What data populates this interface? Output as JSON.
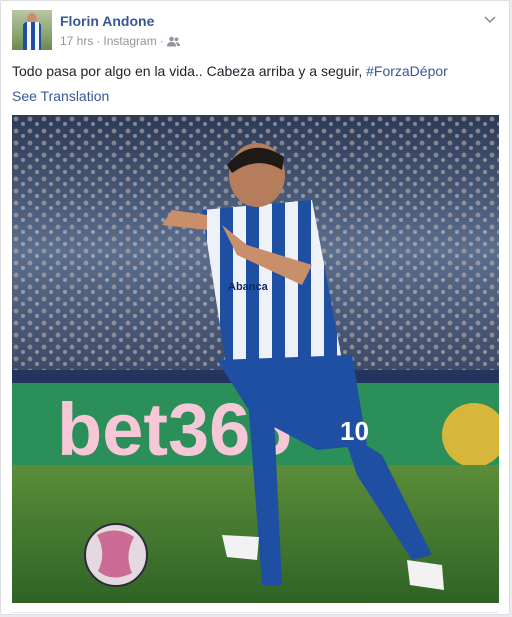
{
  "post": {
    "author": "Florin Andone",
    "time": "17 hrs",
    "source": "Instagram",
    "separator": "·",
    "audience_icon": "friends-icon",
    "menu_icon": "chevron-down-icon",
    "text_main": "Todo pasa por algo en la vida.. Cabeza arriba y a seguir, ",
    "hashtag": "#ForzaDépor",
    "translate_label": "See Translation",
    "photo": {
      "description_icon": "photo",
      "shirt_number": "10",
      "board_text": "bet365",
      "chest_text": "Abanca"
    }
  },
  "colors": {
    "link": "#365899",
    "text": "#1d2129",
    "meta": "#90949c",
    "kit_blue": "#1f4fa3",
    "pitch": "#3f7a2c",
    "board": "#2a8f58"
  }
}
